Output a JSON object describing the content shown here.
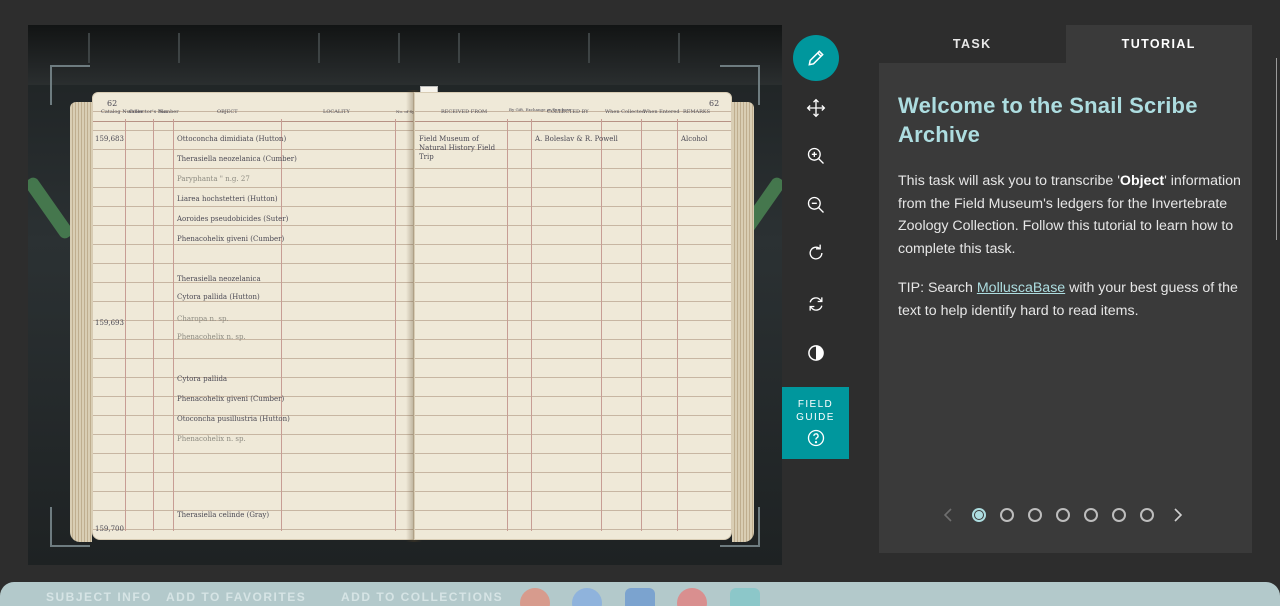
{
  "toolbar": {
    "tools": [
      "annotate",
      "move",
      "zoom-in",
      "zoom-out",
      "rotate",
      "invert",
      "contrast"
    ],
    "field_guide_label": "FIELD GUIDE"
  },
  "panel": {
    "tabs": {
      "task": "TASK",
      "tutorial": "TUTORIAL"
    },
    "title": "Welcome to the Snail Scribe Archive",
    "body_pre": "This task will ask you to transcribe '",
    "body_bold": "Object",
    "body_post": "' information from the Field Museum's ledgers for the Invertebrate Zoology Collection. Follow this tutorial to learn how to complete this task.",
    "tip_pre": "TIP: Search ",
    "tip_link": "MolluscaBase",
    "tip_post": " with your best guess of the text to help identify hard to read items.",
    "step_count": 7,
    "active_step": 1,
    "accent": "#addde0"
  },
  "ledger": {
    "left_page_number": "62",
    "right_page_number": "62",
    "headers": [
      "Catalog Number",
      "Collector's Number",
      "No.",
      "OBJECT",
      "LOCALITY",
      "No. of Specimens",
      "RECEIVED FROM",
      "By Gift, Exchange or Purchase",
      "COLLECTED BY",
      "When Collected",
      "When Entered",
      "REMARKS"
    ],
    "rows": [
      "Ottoconcha dimidiata (Hutton)",
      "Therasiella neozelanica (Cumber)",
      "Paryphanta \" n.g. 27",
      "Liarea hochstetteri (Hutton)",
      "Aoroides pseudobicides (Suter)",
      "Phenacohelix giveni (Cumber)",
      "Therasiella neozelanica",
      "Cytora pallida (Hutton)",
      "Charopa n. sp.",
      "Phenacohelix n. sp.",
      "Cytora pallida",
      "Phenacohelix giveni (Cumber)",
      "Otoconcha pusillustria (Hutton)",
      "Phenacohelix n. sp.",
      "Therasiella celinde (Gray)"
    ],
    "catalog_numbers": [
      "159,683",
      "159,693",
      "159,700"
    ],
    "received_from": "Field Museum of Natural History Field Trip",
    "collected_by": "A. Boleslav & R. Powell",
    "remarks": "Alcohol"
  },
  "bottom_bar": {
    "items": [
      "SUBJECT INFO",
      "ADD TO FAVORITES",
      "ADD TO COLLECTIONS"
    ],
    "bg": "#b3c9cb"
  },
  "colors": {
    "teal": "#00979d",
    "panel_bg": "#3a3a3a",
    "page_bg": "#2d2d2d"
  }
}
